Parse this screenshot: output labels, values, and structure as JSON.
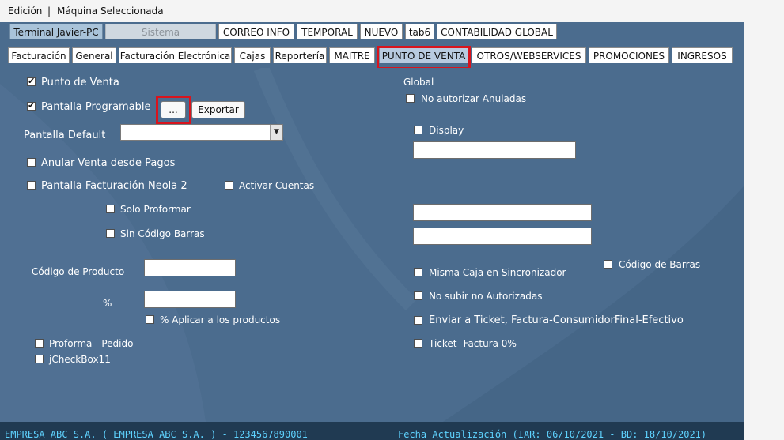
{
  "menu": {
    "edit": "Edición",
    "separator": "|",
    "machine": "Máquina Seleccionada"
  },
  "tabs_top": [
    {
      "label": "Terminal Javier-PC"
    },
    {
      "label": "Sistema"
    },
    {
      "label": "CORREO INFO"
    },
    {
      "label": "TEMPORAL"
    },
    {
      "label": "NUEVO"
    },
    {
      "label": "tab6"
    },
    {
      "label": "CONTABILIDAD GLOBAL"
    }
  ],
  "tabs_second": [
    {
      "label": "Facturación"
    },
    {
      "label": "General"
    },
    {
      "label": "Facturación Electrónica"
    },
    {
      "label": "Cajas"
    },
    {
      "label": "Reportería"
    },
    {
      "label": "MAITRE"
    },
    {
      "label": "PUNTO DE VENTA"
    },
    {
      "label": "OTROS/WEBSERVICES"
    },
    {
      "label": "PROMOCIONES"
    },
    {
      "label": "INGRESOS"
    }
  ],
  "left": {
    "punto_venta": {
      "label": "Punto de Venta",
      "checked": true
    },
    "pantalla_programable": {
      "label": "Pantalla Programable",
      "checked": true
    },
    "dots_button": "...",
    "exportar_button": "Exportar",
    "pantalla_default_label": "Pantalla Default",
    "pantalla_default_value": "",
    "anular_venta": "Anular Venta desde Pagos",
    "pantalla_neola": "Pantalla Facturación Neola 2",
    "activar_cuentas": "Activar Cuentas",
    "solo_proformar": "Solo Proformar",
    "sin_codigo_barras": "Sin Código Barras",
    "codigo_producto_label": "Código de Producto",
    "codigo_producto_value": "",
    "percent_label": "%",
    "percent_value": "",
    "aplicar_productos": "% Aplicar a los productos",
    "proforma_pedido": "Proforma - Pedido",
    "jcheckbox11": "jCheckBox11"
  },
  "right": {
    "global_label": "Global",
    "no_autorizar_anuladas": "No autorizar Anuladas",
    "display": "Display",
    "display_value": "",
    "field2_value": "",
    "field3_value": "",
    "codigo_barras": "Código de Barras",
    "misma_caja": "Misma Caja en Sincronizador",
    "no_subir": "No subir no Autorizadas",
    "enviar_ticket": "Enviar a Ticket, Factura-ConsumidorFinal-Efectivo",
    "ticket_factura": "Ticket- Factura 0%"
  },
  "status": {
    "company": "EMPRESA ABC S.A. ( EMPRESA ABC S.A. ) - 1234567890001",
    "fecha": "Fecha Actualización (IAR: 06/10/2021 - BD: 18/10/2021)"
  },
  "colors": {
    "panel": "#4b6c8e",
    "highlight": "#d9141d",
    "status_text": "#5fd3ff"
  }
}
